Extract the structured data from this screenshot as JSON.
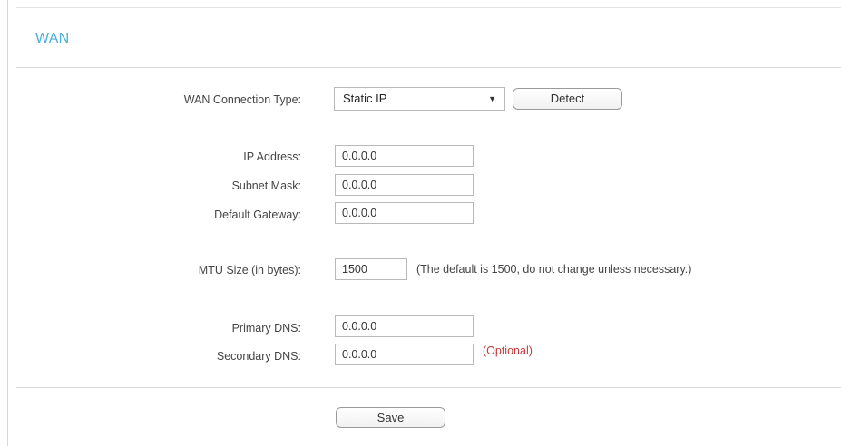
{
  "page": {
    "title": "WAN"
  },
  "form": {
    "connection_type": {
      "label": "WAN Connection Type:",
      "value": "Static IP",
      "detect_label": "Detect"
    },
    "ip_address": {
      "label": "IP Address:",
      "value": "0.0.0.0"
    },
    "subnet_mask": {
      "label": "Subnet Mask:",
      "value": "0.0.0.0"
    },
    "default_gateway": {
      "label": "Default Gateway:",
      "value": "0.0.0.0"
    },
    "mtu": {
      "label": "MTU Size (in bytes):",
      "value": "1500",
      "hint": "(The default is 1500, do not change unless necessary.)"
    },
    "primary_dns": {
      "label": "Primary DNS:",
      "value": "0.0.0.0"
    },
    "secondary_dns": {
      "label": "Secondary DNS:",
      "value": "0.0.0.0",
      "optional_note": "(Optional)"
    }
  },
  "actions": {
    "save_label": "Save"
  },
  "colors": {
    "title": "#4ab0d9",
    "optional_note": "#c43b3b"
  }
}
